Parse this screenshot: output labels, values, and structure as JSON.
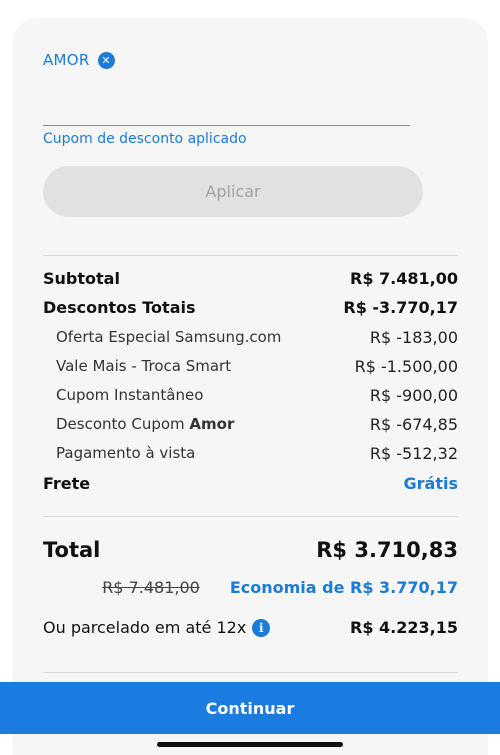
{
  "coupon": {
    "code": "AMOR",
    "input_value": "",
    "helper": "Cupom de desconto aplicado",
    "apply_label": "Aplicar"
  },
  "summary": {
    "subtotal_label": "Subtotal",
    "subtotal_value": "R$ 7.481,00",
    "discounts_label": "Descontos Totais",
    "discounts_value": "R$ -3.770,17",
    "discount_items": [
      {
        "label": "Oferta Especial Samsung.com",
        "value": "R$ -183,00"
      },
      {
        "label": "Vale Mais - Troca Smart",
        "value": "R$ -1.500,00"
      },
      {
        "label": "Cupom Instantâneo",
        "value": "R$ -900,00"
      },
      {
        "label_prefix": "Desconto Cupom ",
        "label_strong": "Amor",
        "value": "R$ -674,85"
      },
      {
        "label": "Pagamento à vista",
        "value": "R$ -512,32"
      }
    ],
    "shipping_label": "Frete",
    "shipping_value": "Grátis"
  },
  "totals": {
    "total_label": "Total",
    "total_value": "R$ 3.710,83",
    "old_price": "R$ 7.481,00",
    "savings": "Economia de R$ 3.770,17",
    "installment_label": "Ou parcelado em até 12x",
    "installment_value": "R$ 4.223,15"
  },
  "actions": {
    "continue_label": "Continuar"
  },
  "colors": {
    "accent": "#1a7cd6",
    "button": "#1a7be0",
    "card_bg": "#f6f6f6"
  }
}
